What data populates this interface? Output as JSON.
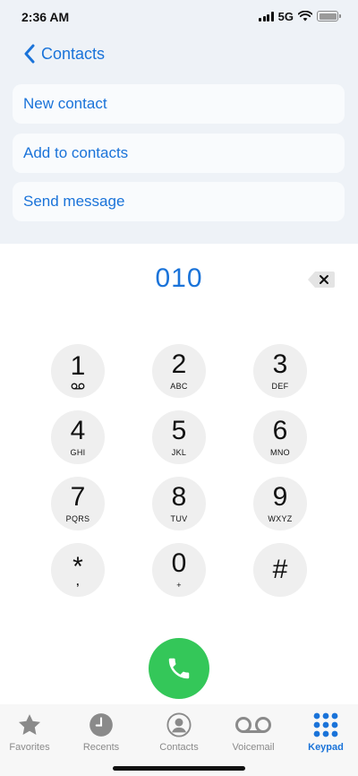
{
  "status": {
    "time": "2:36 AM",
    "network": "5G"
  },
  "nav": {
    "back_label": "Contacts"
  },
  "actions": [
    {
      "label": "New contact"
    },
    {
      "label": "Add to contacts"
    },
    {
      "label": "Send message"
    }
  ],
  "dialer": {
    "number": "010"
  },
  "keys": [
    {
      "digit": "1",
      "letters": ""
    },
    {
      "digit": "2",
      "letters": "ABC"
    },
    {
      "digit": "3",
      "letters": "DEF"
    },
    {
      "digit": "4",
      "letters": "GHI"
    },
    {
      "digit": "5",
      "letters": "JKL"
    },
    {
      "digit": "6",
      "letters": "MNO"
    },
    {
      "digit": "7",
      "letters": "PQRS"
    },
    {
      "digit": "8",
      "letters": "TUV"
    },
    {
      "digit": "9",
      "letters": "WXYZ"
    },
    {
      "digit": "*",
      "letters": ","
    },
    {
      "digit": "0",
      "letters": "+"
    },
    {
      "digit": "#",
      "letters": ""
    }
  ],
  "tabs": [
    {
      "label": "Favorites",
      "icon": "star-icon"
    },
    {
      "label": "Recents",
      "icon": "clock-icon"
    },
    {
      "label": "Contacts",
      "icon": "person-icon"
    },
    {
      "label": "Voicemail",
      "icon": "voicemail-icon"
    },
    {
      "label": "Keypad",
      "icon": "keypad-icon",
      "active": true
    }
  ],
  "colors": {
    "accent": "#1a73d9",
    "call": "#34c759",
    "key_bg": "#efefef",
    "header_bg": "#eef2f7"
  }
}
